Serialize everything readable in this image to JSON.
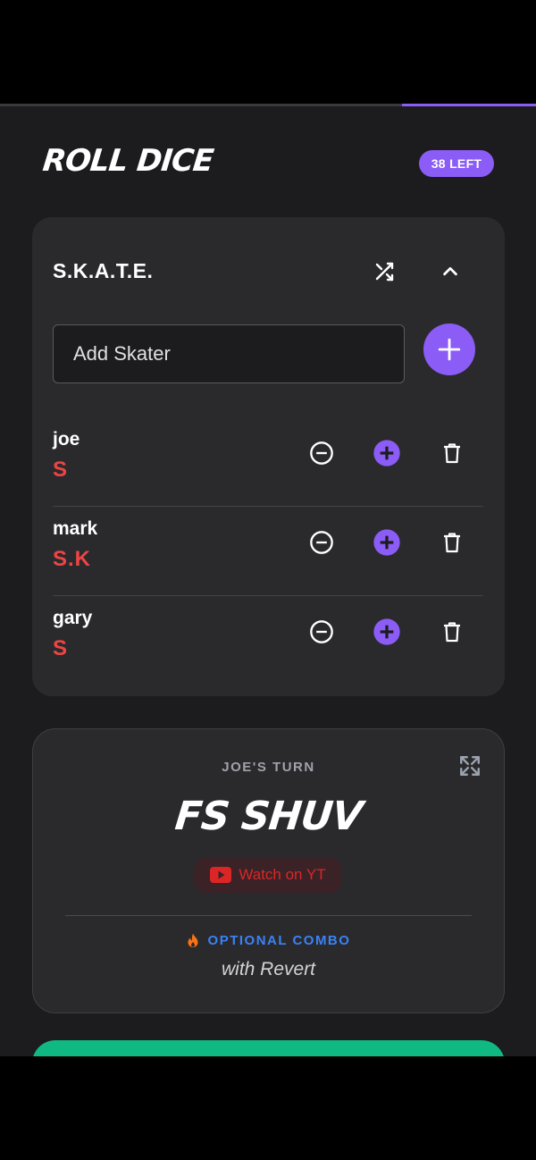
{
  "progress": {
    "remaining_fraction": 0.25
  },
  "header": {
    "title": "ROLL DICE",
    "left_badge": "38 LEFT"
  },
  "game": {
    "title": "S.K.A.T.E.",
    "shuffle_icon": "shuffle-icon",
    "collapse_icon": "chevron-up-icon",
    "add_skater_placeholder": "Add Skater",
    "skaters": [
      {
        "name": "joe",
        "letters": "S"
      },
      {
        "name": "mark",
        "letters": "S.K"
      },
      {
        "name": "gary",
        "letters": "S"
      }
    ]
  },
  "trick": {
    "turn_label": "JOE'S TURN",
    "name": "FS SHUV",
    "watch_label": "Watch on YT",
    "combo_label": "OPTIONAL COMBO",
    "combo_text": "with Revert"
  },
  "colors": {
    "accent": "#8b5cf6",
    "letters": "#ef4444",
    "combo": "#3b82f6",
    "roll": "#10b981",
    "youtube": "#dc2626"
  }
}
